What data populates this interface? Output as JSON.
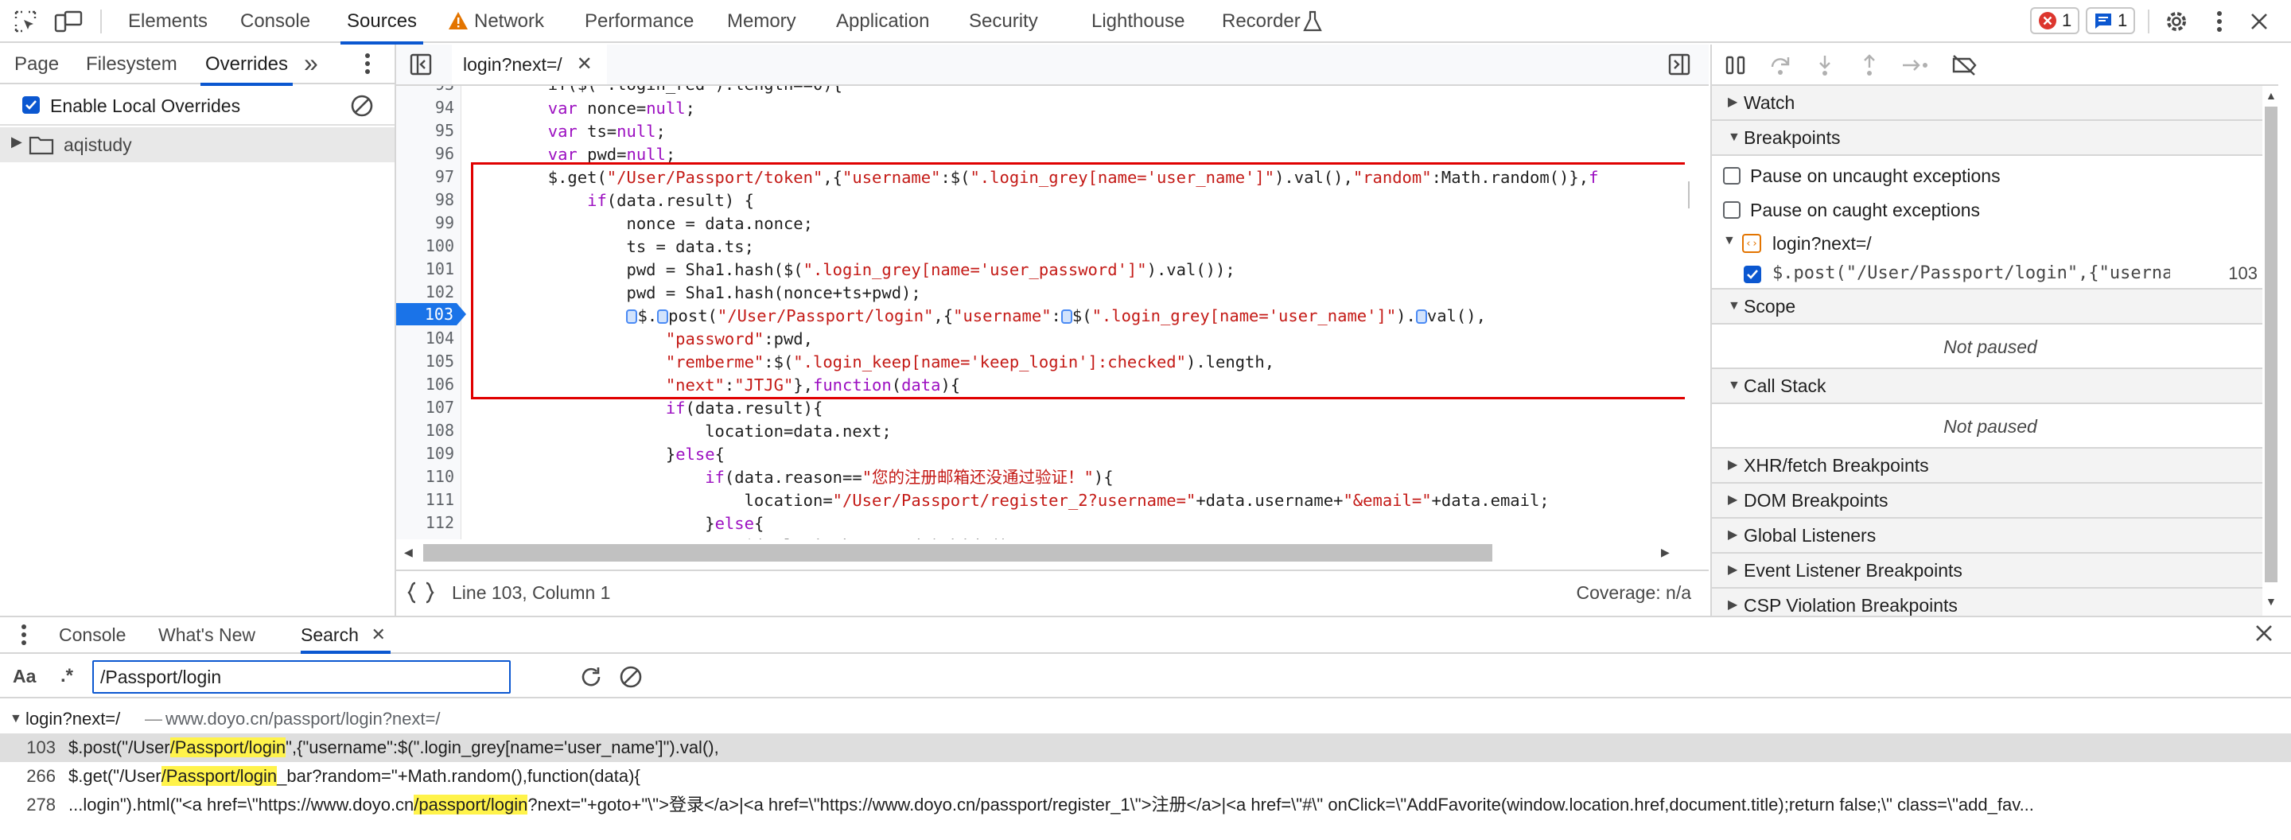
{
  "toolbar": {
    "tabs": [
      "Elements",
      "Console",
      "Sources",
      "Network",
      "Performance",
      "Memory",
      "Application",
      "Security",
      "Lighthouse",
      "Recorder"
    ],
    "error_count": "1",
    "message_count": "1"
  },
  "navigator": {
    "tabs": [
      "Page",
      "Filesystem",
      "Overrides"
    ],
    "more_label": "»",
    "enable_overrides_label": "Enable Local Overrides",
    "folder_name": "aqistudy"
  },
  "editor": {
    "file_tab": "login?next=/",
    "lines": [
      {
        "n": "94",
        "code": "        var nonce=null;"
      },
      {
        "n": "95",
        "code": "        var ts=null;"
      },
      {
        "n": "96",
        "code": "        var pwd=null;"
      },
      {
        "n": "97",
        "code": "        $.get(\"/User/Passport/token\",{\"username\":$(\".login_grey[name='user_name']\").val(),\"random\":Math.random()},f"
      },
      {
        "n": "98",
        "code": "            if(data.result) {"
      },
      {
        "n": "99",
        "code": "                nonce = data.nonce;"
      },
      {
        "n": "100",
        "code": "                ts = data.ts;"
      },
      {
        "n": "101",
        "code": "                pwd = Sha1.hash($(\".login_grey[name='user_password']\").val());"
      },
      {
        "n": "102",
        "code": "                pwd = Sha1.hash(nonce+ts+pwd);"
      },
      {
        "n": "103",
        "code": "                $.post(\"/User/Passport/login\",{\"username\":$(\".login_grey[name='user_name']\").val(),"
      },
      {
        "n": "104",
        "code": "                    \"password\":pwd,"
      },
      {
        "n": "105",
        "code": "                    \"remberme\":$(\".login_keep[name='keep_login']:checked\").length,"
      },
      {
        "n": "106",
        "code": "                    \"next\":\"JTJG\"},function(data){"
      },
      {
        "n": "107",
        "code": "                    if(data.result){"
      },
      {
        "n": "108",
        "code": "                        location=data.next;"
      },
      {
        "n": "109",
        "code": "                    }else{"
      },
      {
        "n": "110",
        "code": "                        if(data.reason==\"您的注册邮箱还没通过验证！\"){"
      },
      {
        "n": "111",
        "code": "                            location=\"/User/Passport/register_2?username=\"+data.username+\"&email=\"+data.email;"
      },
      {
        "n": "112",
        "code": "                        }else{"
      }
    ],
    "status_position": "Line 103, Column 1",
    "status_coverage": "Coverage: n/a"
  },
  "debugger": {
    "watch": "Watch",
    "breakpoints": "Breakpoints",
    "pause_uncaught": "Pause on uncaught exceptions",
    "pause_caught": "Pause on caught exceptions",
    "bp_file": "login?next=/",
    "bp_code": "$.post(\"/User/Passport/login\",{\"usernam…",
    "bp_line": "103",
    "scope": "Scope",
    "not_paused": "Not paused",
    "call_stack": "Call Stack",
    "not_paused_2": "Not paused",
    "xhr": "XHR/fetch Breakpoints",
    "dom": "DOM Breakpoints",
    "global": "Global Listeners",
    "event": "Event Listener Breakpoints",
    "csp": "CSP Violation Breakpoints"
  },
  "drawer": {
    "tabs": [
      "Console",
      "What's New",
      "Search"
    ],
    "case_label": "Aa",
    "regex_label": ".*",
    "search_value": "/Passport/login",
    "result_file": "login?next=/",
    "result_sep": "—",
    "result_url": "www.doyo.cn/passport/login?next=/",
    "results": [
      {
        "n": "103",
        "pre": "$.post(\"/User",
        "hl": "/Passport/login",
        "post": "\",{\"username\":$(\".login_grey[name='user_name']\").val(),"
      },
      {
        "n": "266",
        "pre": "$.get(\"/User",
        "hl": "/Passport/login",
        "post": "_bar?random=\"+Math.random(),function(data){"
      },
      {
        "n": "278",
        "pre": "...login\").html(\"<a href=\\\"https://www.doyo.cn",
        "hl": "/passport/login",
        "post": "?next=\"+goto+\"\\\">登录</a>|<a href=\\\"https://www.doyo.cn/passport/register_1\\\">注册</a>|<a href=\\\"#\\\" onClick=\\\"AddFavorite(window.location.href,document.title);return false;\\\" class=\\\"add_fav..."
      }
    ]
  },
  "colors": {
    "accent": "#0b57d0",
    "highlight_box": "#e00000",
    "search_highlight": "#fff34a",
    "current_line": "#1a73e8"
  }
}
